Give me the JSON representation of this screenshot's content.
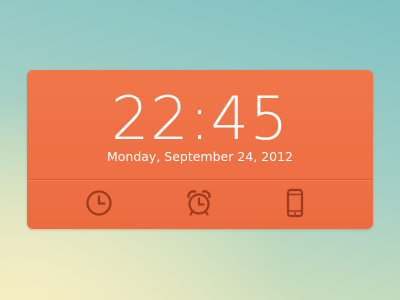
{
  "clock": {
    "time": "22:45",
    "date": "Monday, September 24, 2012"
  },
  "tabs": [
    {
      "icon": "clock-icon"
    },
    {
      "icon": "alarm-clock-icon"
    },
    {
      "icon": "phone-icon"
    }
  ],
  "colors": {
    "panel": "#ee7044",
    "icon": "#9e3a1e",
    "text": "#ffffff"
  }
}
